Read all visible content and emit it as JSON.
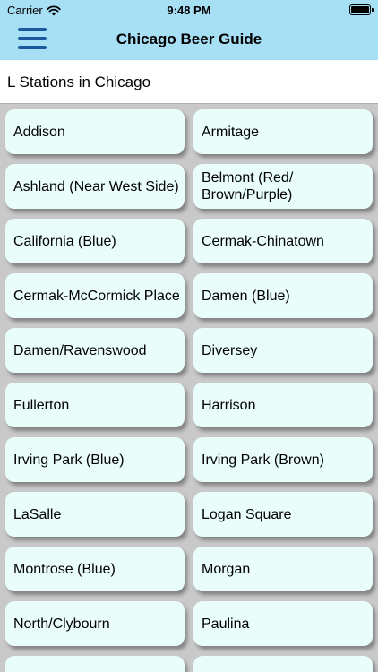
{
  "status": {
    "carrier": "Carrier",
    "time": "9:48 PM"
  },
  "navbar": {
    "title": "Chicago Beer Guide"
  },
  "subheader": {
    "title": "L Stations in Chicago"
  },
  "stations": [
    "Addison",
    "Armitage",
    "Ashland (Near West Side)",
    "Belmont (Red/ Brown/Purple)",
    "California (Blue)",
    "Cermak-Chinatown",
    "Cermak-McCormick Place",
    "Damen (Blue)",
    "Damen/Ravenswood",
    "Diversey",
    "Fullerton",
    "Harrison",
    "Irving Park (Blue)",
    "Irving Park (Brown)",
    "LaSalle",
    "Logan Square",
    "Montrose (Blue)",
    "Morgan",
    "North/Clybourn",
    "Paulina",
    "",
    ""
  ],
  "colors": {
    "header_bg": "#a7dff4",
    "button_bg": "#e9fdfb",
    "menu_icon": "#1a5a9c",
    "background": "#c9c9c9"
  }
}
